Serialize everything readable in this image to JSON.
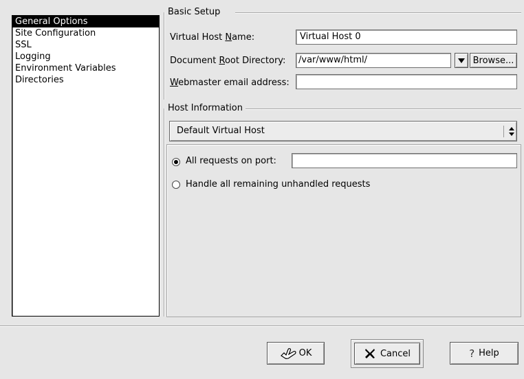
{
  "sidebar": {
    "items": [
      {
        "label": "General Options",
        "selected": true
      },
      {
        "label": "Site Configuration",
        "selected": false
      },
      {
        "label": "SSL",
        "selected": false
      },
      {
        "label": "Logging",
        "selected": false
      },
      {
        "label": "Environment Variables",
        "selected": false
      },
      {
        "label": "Directories",
        "selected": false
      }
    ]
  },
  "basic_setup": {
    "title": "Basic Setup",
    "virtual_host_name_label_pre": "Virtual Host ",
    "virtual_host_name_label_key": "N",
    "virtual_host_name_label_post": "ame:",
    "virtual_host_name_value": "Virtual Host 0",
    "doc_root_label_pre": "Document ",
    "doc_root_label_key": "R",
    "doc_root_label_post": "oot Directory:",
    "doc_root_value": "/var/www/html/",
    "browse_label": "Browse...",
    "webmaster_label_key": "W",
    "webmaster_label_post": "ebmaster email address:",
    "webmaster_value": ""
  },
  "host_info": {
    "title": "Host Information",
    "host_type_selected": "Default Virtual Host",
    "radio_all_ports_label": "All requests on port",
    "radio_all_ports_checked": true,
    "port_value": "",
    "radio_unhandled_label": "Handle all remaining unhandled requests",
    "radio_unhandled_checked": false
  },
  "buttons": {
    "ok": "OK",
    "cancel": "Cancel",
    "help": "Help"
  }
}
